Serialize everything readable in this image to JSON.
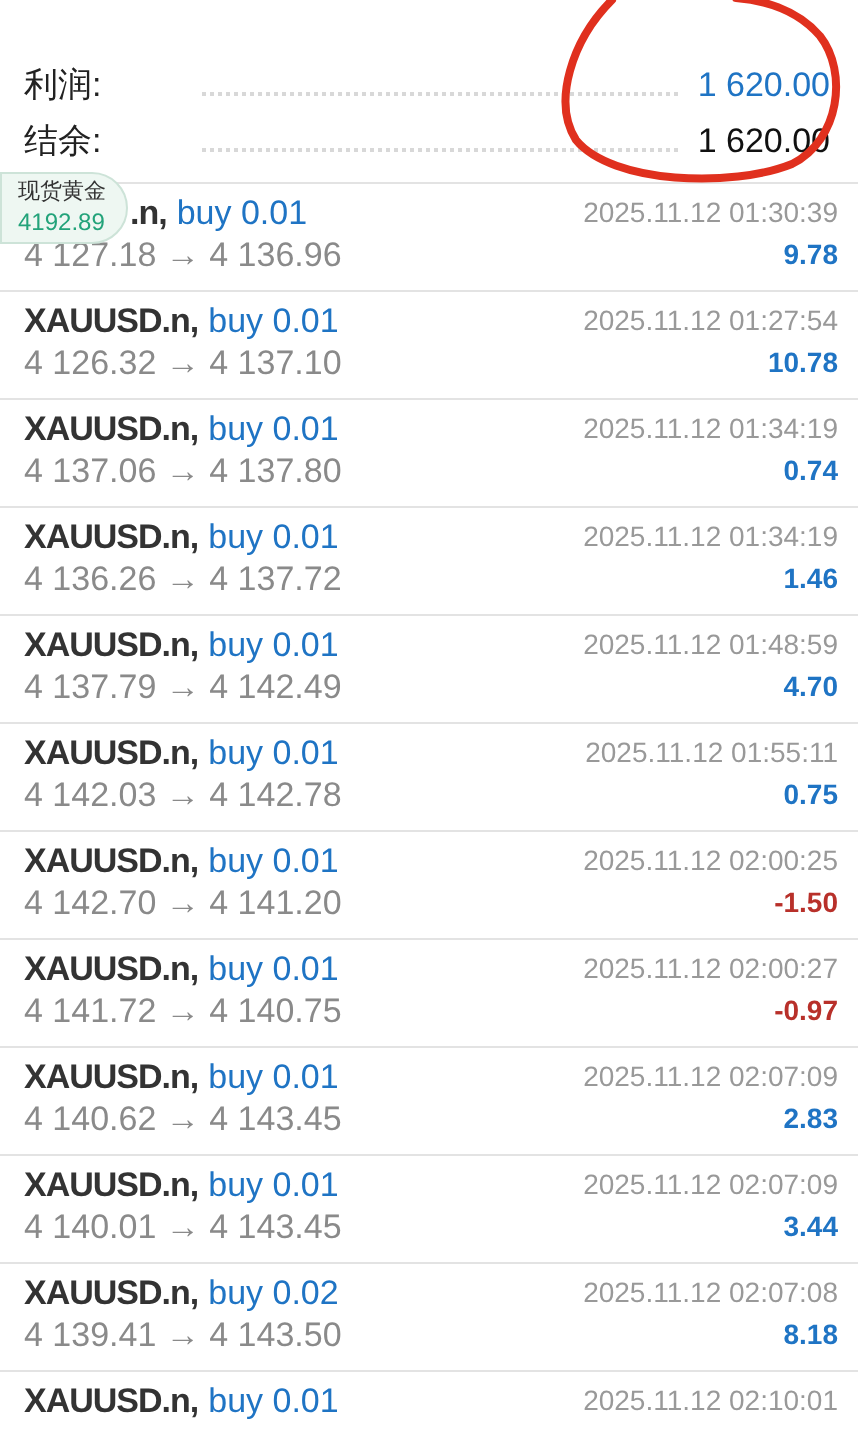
{
  "summary": [
    {
      "label": "利润:",
      "value": "1 620.00",
      "color": "#1f74c4"
    },
    {
      "label": "结余:",
      "value": "1 620.00",
      "color": "#111111"
    }
  ],
  "quote_badge": {
    "name": "现货黄金",
    "price": "4192.89"
  },
  "trades": [
    {
      "symbol": ".n,",
      "order": "buy 0.01",
      "prices": "4 127.18 → 4 136.96",
      "time": "2025.11.12 01:30:39",
      "profit": "9.78",
      "color": "#1f74c4"
    },
    {
      "symbol": "XAUUSD.n,",
      "order": "buy 0.01",
      "prices": "4 126.32 → 4 137.10",
      "time": "2025.11.12 01:27:54",
      "profit": "10.78",
      "color": "#1f74c4"
    },
    {
      "symbol": "XAUUSD.n,",
      "order": "buy 0.01",
      "prices": "4 137.06 → 4 137.80",
      "time": "2025.11.12 01:34:19",
      "profit": "0.74",
      "color": "#1f74c4"
    },
    {
      "symbol": "XAUUSD.n,",
      "order": "buy 0.01",
      "prices": "4 136.26 → 4 137.72",
      "time": "2025.11.12 01:34:19",
      "profit": "1.46",
      "color": "#1f74c4"
    },
    {
      "symbol": "XAUUSD.n,",
      "order": "buy 0.01",
      "prices": "4 137.79 → 4 142.49",
      "time": "2025.11.12 01:48:59",
      "profit": "4.70",
      "color": "#1f74c4"
    },
    {
      "symbol": "XAUUSD.n,",
      "order": "buy 0.01",
      "prices": "4 142.03 → 4 142.78",
      "time": "2025.11.12 01:55:11",
      "profit": "0.75",
      "color": "#1f74c4"
    },
    {
      "symbol": "XAUUSD.n,",
      "order": "buy 0.01",
      "prices": "4 142.70 → 4 141.20",
      "time": "2025.11.12 02:00:25",
      "profit": "-1.50",
      "color": "#b8302a"
    },
    {
      "symbol": "XAUUSD.n,",
      "order": "buy 0.01",
      "prices": "4 141.72 → 4 140.75",
      "time": "2025.11.12 02:00:27",
      "profit": "-0.97",
      "color": "#b8302a"
    },
    {
      "symbol": "XAUUSD.n,",
      "order": "buy 0.01",
      "prices": "4 140.62 → 4 143.45",
      "time": "2025.11.12 02:07:09",
      "profit": "2.83",
      "color": "#1f74c4"
    },
    {
      "symbol": "XAUUSD.n,",
      "order": "buy 0.01",
      "prices": "4 140.01 → 4 143.45",
      "time": "2025.11.12 02:07:09",
      "profit": "3.44",
      "color": "#1f74c4"
    },
    {
      "symbol": "XAUUSD.n,",
      "order": "buy 0.02",
      "prices": "4 139.41 → 4 143.50",
      "time": "2025.11.12 02:07:08",
      "profit": "8.18",
      "color": "#1f74c4"
    },
    {
      "symbol": "XAUUSD.n,",
      "order": "buy 0.01",
      "time": "2025.11.12 02:10:01"
    }
  ]
}
